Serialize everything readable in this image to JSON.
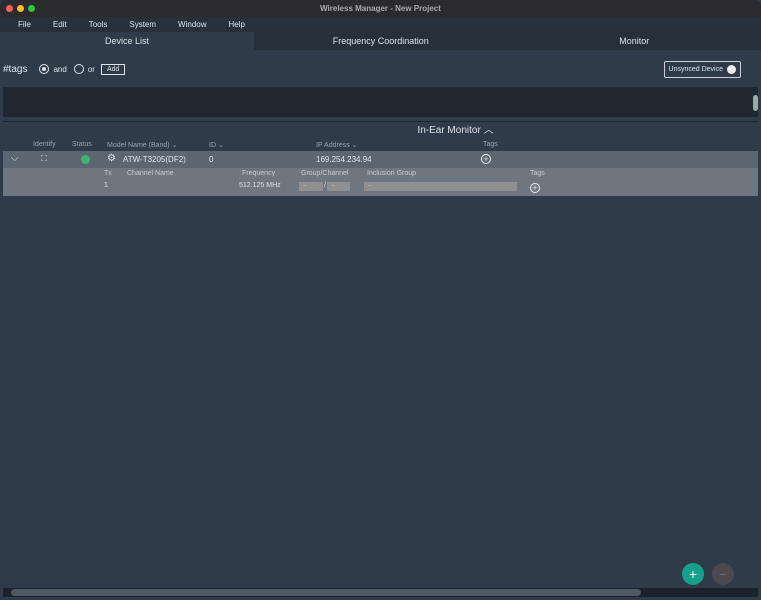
{
  "window": {
    "title": "Wireless Manager - New Project"
  },
  "menu": [
    "File",
    "Edit",
    "Tools",
    "System",
    "Window",
    "Help"
  ],
  "tabs": [
    {
      "label": "Device List",
      "active": true
    },
    {
      "label": "Frequency Coordination"
    },
    {
      "label": "Monitor"
    }
  ],
  "tags": {
    "label": "#tags",
    "and": "and",
    "or": "or",
    "selected": "and",
    "add": "Add"
  },
  "unsynced": "Unsynced Device",
  "group": {
    "title": "In-Ear Monitor",
    "chevron": "^"
  },
  "columns": [
    "Identify",
    "Status",
    "Model Name (Band) ⌄",
    "ID ⌄",
    "IP Address ⌄",
    "Tags"
  ],
  "device": {
    "model": "ATW-T3205(DF2)",
    "id": "0",
    "ip": "169.254.234.94",
    "status_color": "#3cb371"
  },
  "sub_columns": [
    "Tx",
    "Channel Name",
    "Frequency",
    "Group/Channel",
    "Inclusion Group",
    "Tags"
  ],
  "channel": {
    "tx": "1",
    "name": "",
    "frequency": "512.125 MHz",
    "group": "--",
    "channel": "--",
    "sep": "/",
    "inclusion": "--"
  },
  "buttons": {
    "add": "+",
    "remove": "−"
  },
  "accent": "#16a08b"
}
